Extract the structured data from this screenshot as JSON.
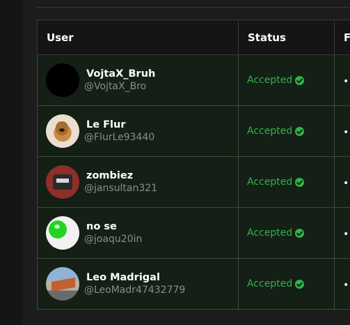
{
  "table": {
    "headers": {
      "user": "User",
      "status": "Status",
      "f": "F"
    },
    "rows": [
      {
        "display_name": "VojtaX_Bruh",
        "handle": "@VojtaX_Bro",
        "status": "Accepted",
        "f": "•",
        "avatar": "black-avatar"
      },
      {
        "display_name": "Le Flur",
        "handle": "@FlurLe93440",
        "status": "Accepted",
        "f": "•",
        "avatar": "dog-avatar"
      },
      {
        "display_name": "zombiez",
        "handle": "@jansultan321",
        "status": "Accepted",
        "f": "•",
        "avatar": "zombie-avatar"
      },
      {
        "display_name": "no se",
        "handle": "@joaqu20in",
        "status": "Accepted",
        "f": "•",
        "avatar": "green-cup-avatar"
      },
      {
        "display_name": "Leo Madrigal",
        "handle": "@LeoMadr47432779",
        "status": "Accepted",
        "f": "•",
        "avatar": "train-avatar"
      }
    ]
  },
  "colors": {
    "accepted": "#2fb34a",
    "row_bg": "#141f16",
    "header_bg": "#151515",
    "page_bg": "#1c1c1c"
  }
}
